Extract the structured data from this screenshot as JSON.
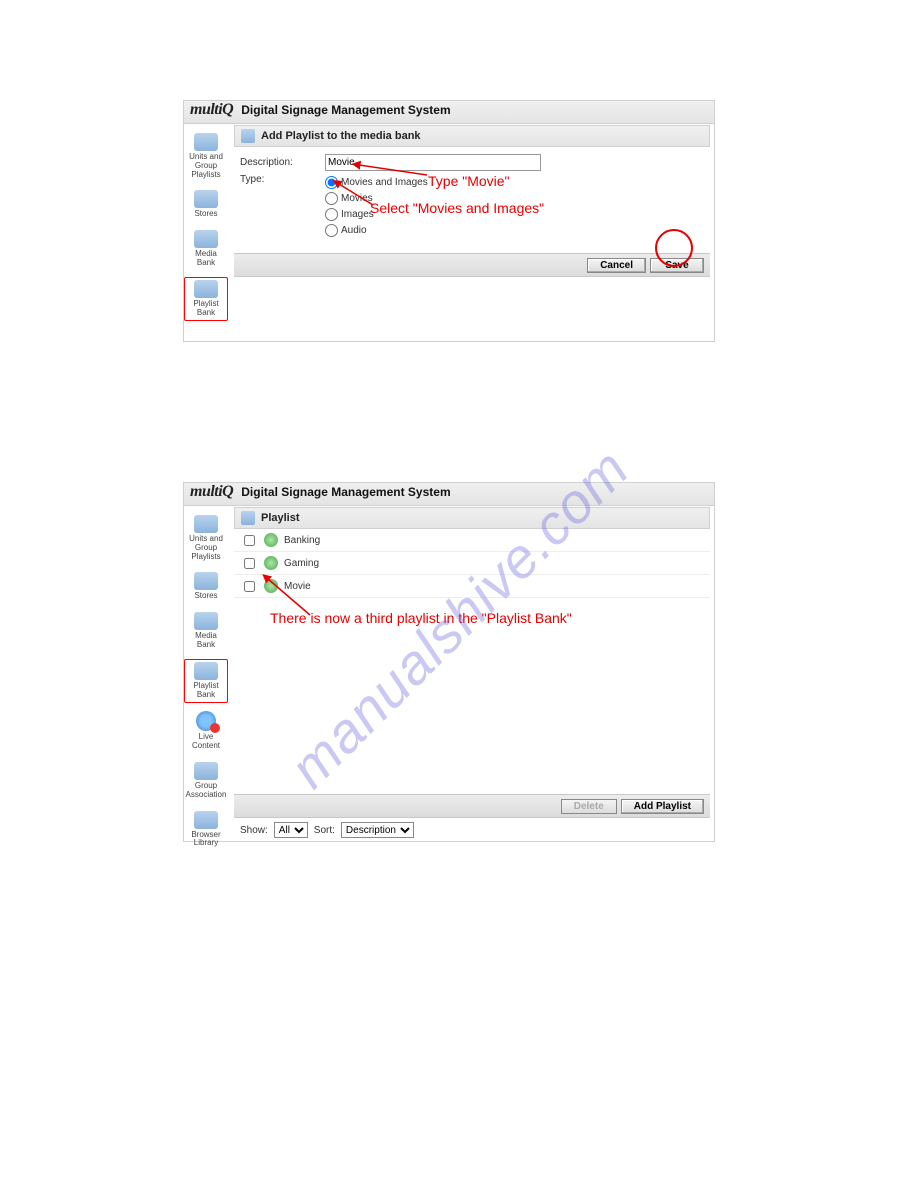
{
  "app_title": "Digital Signage Management System",
  "logo_text": "multiQ",
  "screenshot1": {
    "sidebar": [
      {
        "label": "Units and Group Playlists",
        "name": "units-groups"
      },
      {
        "label": "Stores",
        "name": "stores"
      },
      {
        "label": "Media Bank",
        "name": "media-bank"
      },
      {
        "label": "Playlist Bank",
        "name": "playlist-bank"
      }
    ],
    "panel_title": "Add Playlist to the media bank",
    "desc_label": "Description:",
    "desc_value": "Movie",
    "type_label": "Type:",
    "type_options": [
      "Movies and Images",
      "Movies",
      "Images",
      "Audio"
    ],
    "type_selected": 0,
    "buttons": {
      "cancel": "Cancel",
      "save": "Save"
    }
  },
  "screenshot2": {
    "sidebar": [
      {
        "label": "Units and Group Playlists",
        "name": "units-groups"
      },
      {
        "label": "Stores",
        "name": "stores"
      },
      {
        "label": "Media Bank",
        "name": "media-bank"
      },
      {
        "label": "Playlist Bank",
        "name": "playlist-bank"
      },
      {
        "label": "Live Content",
        "name": "live-content",
        "globe": true
      },
      {
        "label": "Group Association",
        "name": "group-association"
      },
      {
        "label": "Browser Library",
        "name": "browser-library"
      }
    ],
    "panel_title": "Playlist",
    "playlists": [
      "Banking",
      "Gaming",
      "Movie"
    ],
    "buttons": {
      "delete": "Delete",
      "add": "Add Playlist"
    },
    "show_label": "Show:",
    "show_value": "All",
    "sort_label": "Sort:",
    "sort_value": "Description"
  },
  "annotations": {
    "type_movie": "Type \"Movie\"",
    "select_movies_images": "Select \"Movies and Images\"",
    "third_playlist": "There is now a third playlist in the \"Playlist Bank\""
  },
  "watermark": "manualshive.com"
}
